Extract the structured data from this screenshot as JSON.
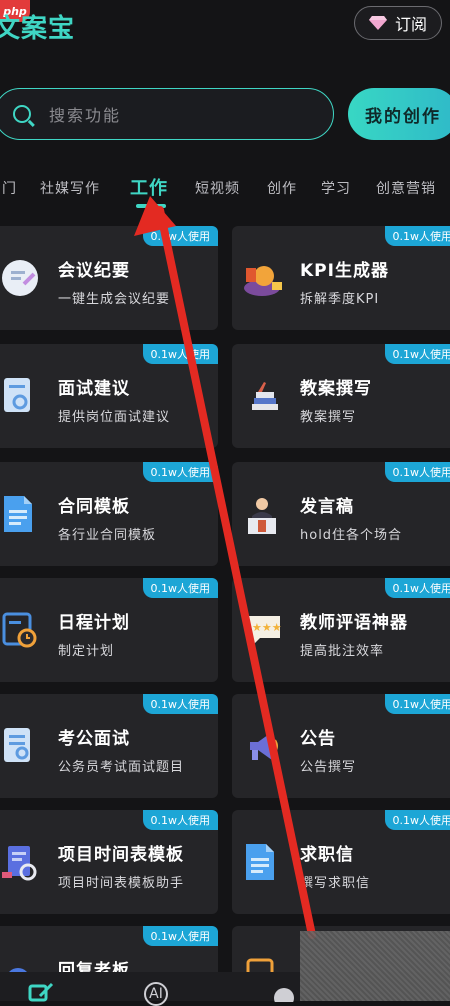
{
  "header": {
    "badge": "php",
    "app_title": "文案宝",
    "subscribe_label": "订阅"
  },
  "search": {
    "placeholder": "搜索功能",
    "create_label": "我的创作"
  },
  "tabs": [
    {
      "label": "门"
    },
    {
      "label": "社媒写作"
    },
    {
      "label": "工作"
    },
    {
      "label": "短视频"
    },
    {
      "label": "创作"
    },
    {
      "label": "学习"
    },
    {
      "label": "创意营销"
    }
  ],
  "cards": [
    {
      "title": "会议纪要",
      "desc": "一键生成会议纪要",
      "badge": "0.1w人使用",
      "icon": "meeting-notes-icon"
    },
    {
      "title": "KPI生成器",
      "desc": "拆解季度KPI",
      "badge": "0.1w人使用",
      "icon": "kpi-icon"
    },
    {
      "title": "面试建议",
      "desc": "提供岗位面试建议",
      "badge": "0.1w人使用",
      "icon": "interview-icon"
    },
    {
      "title": "教案撰写",
      "desc": "教案撰写",
      "badge": "0.1w人使用",
      "icon": "lesson-plan-icon"
    },
    {
      "title": "合同模板",
      "desc": "各行业合同模板",
      "badge": "0.1w人使用",
      "icon": "contract-icon"
    },
    {
      "title": "发言稿",
      "desc": "hold住各个场合",
      "badge": "0.1w人使用",
      "icon": "speech-icon"
    },
    {
      "title": "日程计划",
      "desc": "制定计划",
      "badge": "0.1w人使用",
      "icon": "schedule-icon"
    },
    {
      "title": "教师评语神器",
      "desc": "提高批注效率",
      "badge": "0.1w人使用",
      "icon": "teacher-comment-icon"
    },
    {
      "title": "考公面试",
      "desc": "公务员考试面试题目",
      "badge": "0.1w人使用",
      "icon": "civil-exam-icon"
    },
    {
      "title": "公告",
      "desc": "公告撰写",
      "badge": "0.1w人使用",
      "icon": "announcement-icon"
    },
    {
      "title": "项目时间表模板",
      "desc": "项目时间表模板助手",
      "badge": "0.1w人使用",
      "icon": "project-timeline-icon"
    },
    {
      "title": "求职信",
      "desc": "撰写求职信",
      "badge": "0.1w人使用",
      "icon": "cover-letter-icon"
    },
    {
      "title": "回复老板",
      "desc": "",
      "badge": "0.1w人使用",
      "icon": "reply-boss-icon"
    },
    {
      "title": "",
      "desc": "",
      "badge": "",
      "icon": "doc-icon"
    }
  ],
  "bottom_nav": {
    "ai_label": "AI"
  },
  "colors": {
    "accent": "#3fd6c4",
    "badge": "#1da6d6",
    "card_bg": "#252528",
    "arrow": "#e32a22"
  }
}
